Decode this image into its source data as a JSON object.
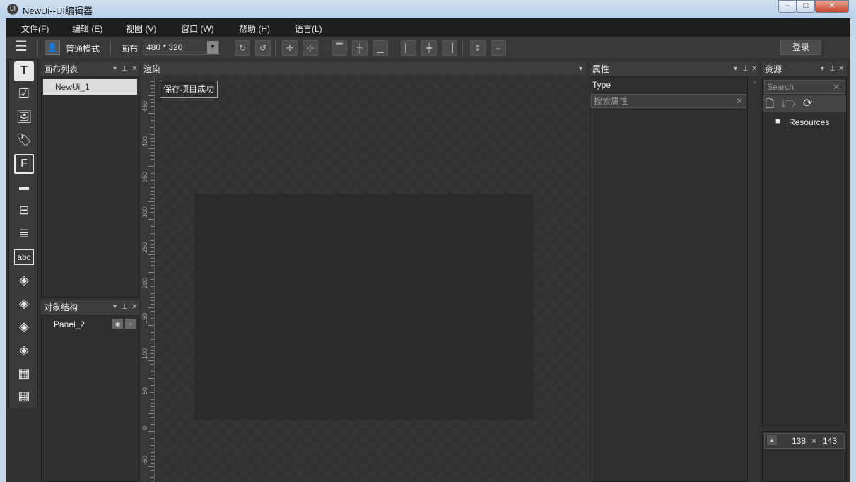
{
  "window": {
    "title": "NewUi--UI编辑器"
  },
  "menu": [
    "文件(F)",
    "编辑 (E)",
    "视图 (V)",
    "窗口 (W)",
    "帮助 (H)",
    "语言(L)"
  ],
  "toolbar": {
    "mode_label": "普通模式",
    "canvas_label": "画布",
    "canvas_size": "480 * 320",
    "login_label": "登录"
  },
  "panels": {
    "canvas_list": {
      "title": "画布列表",
      "items": [
        "NewUi_1"
      ]
    },
    "object_tree": {
      "title": "对象结构",
      "items": [
        "Panel_2"
      ]
    },
    "render": {
      "title": "渲染",
      "status": "保存项目成功"
    },
    "properties": {
      "title": "属性",
      "type_label": "Type",
      "search_placeholder": "搜索属性"
    },
    "resources": {
      "title": "资源",
      "search_placeholder": "Search",
      "folders": [
        "Resources"
      ],
      "preview_w": "138",
      "preview_x": "×",
      "preview_h": "143"
    }
  },
  "ruler": {
    "labels": [
      "450",
      "400",
      "350",
      "300",
      "250",
      "200",
      "150",
      "100",
      "50",
      "0",
      "-50"
    ]
  },
  "colors": {
    "background": "#2d2d2d",
    "panel": "#3c3c3c",
    "titlebar": "#c5d7ea"
  }
}
